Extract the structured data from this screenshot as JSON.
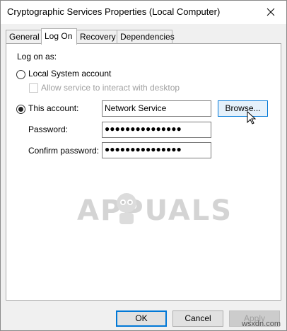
{
  "window": {
    "title": "Cryptographic Services Properties (Local Computer)"
  },
  "tabs": [
    {
      "label": "General"
    },
    {
      "label": "Log On"
    },
    {
      "label": "Recovery"
    },
    {
      "label": "Dependencies"
    }
  ],
  "logon": {
    "heading": "Log on as:",
    "local_system_label": "Local System account",
    "allow_interact_label": "Allow service to interact with desktop",
    "this_account_label": "This account:",
    "account_value": "Network Service",
    "browse_label": "Browse...",
    "password_label": "Password:",
    "password_value": "●●●●●●●●●●●●●●●",
    "confirm_label": "Confirm password:",
    "confirm_value": "●●●●●●●●●●●●●●●",
    "selected_option": "this_account"
  },
  "watermark": {
    "text": "APPUALS",
    "site": "wsxdn.com"
  },
  "buttons": {
    "ok": "OK",
    "cancel": "Cancel",
    "apply": "Apply"
  },
  "icons": {
    "close": "close-icon",
    "cursor": "mouse-pointer-icon",
    "logo": "appuals-mascot-icon"
  }
}
